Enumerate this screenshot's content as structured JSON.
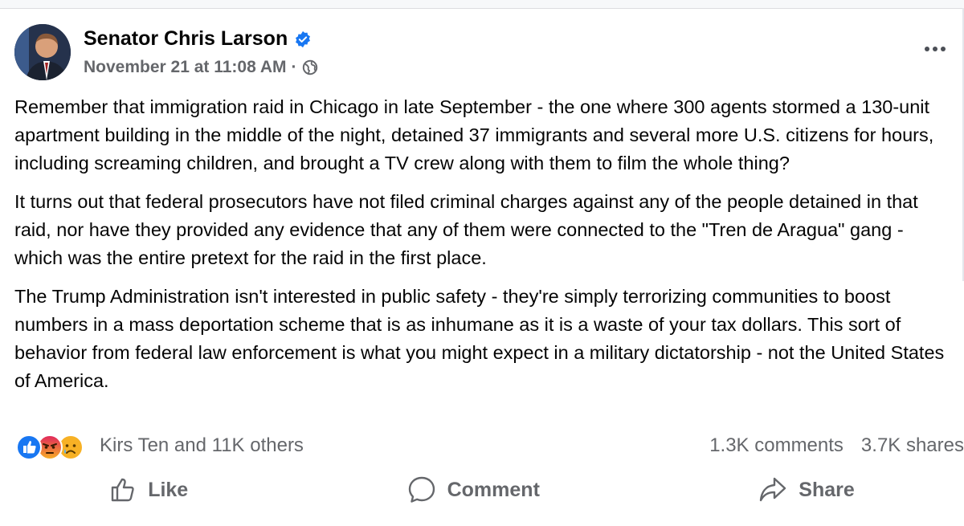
{
  "post": {
    "author": "Senator Chris Larson",
    "timestamp": "November 21 at 11:08 AM",
    "separator": "·",
    "privacy_icon": "globe-icon",
    "verified_icon": "verified-badge-icon",
    "paragraphs": [
      "Remember that immigration raid in Chicago in late September - the one where 300 agents stormed a 130-unit apartment building in the middle of the night, detained 37 immigrants and several more U.S. citizens for hours, including screaming children, and brought a TV crew along with them to film the whole thing?",
      "It turns out that federal prosecutors have not filed criminal charges against any of the people detained in that raid, nor have they provided any evidence that any of them were connected to the \"Tren de Aragua\" gang - which was the entire pretext for the raid in the first place.",
      "The Trump Administration isn't interested in public safety - they're simply terrorizing communities to boost numbers in a mass deportation scheme that is as inhumane as it is a waste of your tax dollars. This sort of behavior from federal law enforcement is what you might expect in a military dictatorship - not the United States of America."
    ]
  },
  "reactions": {
    "icons": [
      "like-reaction-icon",
      "angry-reaction-icon",
      "sad-reaction-icon"
    ],
    "summary": "Kirs Ten and 11K others",
    "comments": "1.3K comments",
    "shares": "3.7K shares"
  },
  "actions": {
    "like": "Like",
    "comment": "Comment",
    "share": "Share"
  },
  "colors": {
    "accent": "#1877f2",
    "secondary_text": "#65676b",
    "angry": "#e9710f",
    "sad": "#f7b125"
  }
}
